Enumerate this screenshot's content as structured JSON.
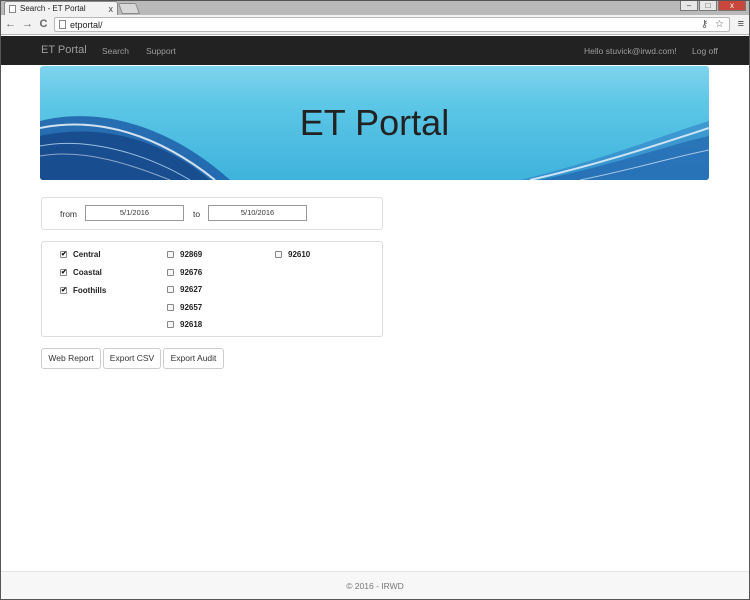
{
  "browser": {
    "tab_title": "Search - ET Portal",
    "tab_close": "x",
    "url": "etportal/",
    "win_min": "–",
    "win_max": "□",
    "win_close": "x",
    "back": "←",
    "forward": "→",
    "reload": "C",
    "url_icons": "⚷ ☆",
    "menu": "≡"
  },
  "navbar": {
    "brand": "ET Portal",
    "links": [
      "Search",
      "Support"
    ],
    "hello": "Hello stuvick@irwd.com!",
    "logoff": "Log off"
  },
  "banner": {
    "title": "ET Portal"
  },
  "date_filter": {
    "from_label": "from",
    "from_value": "5/1/2016",
    "to_label": "to",
    "to_value": "5/10/2016"
  },
  "regions": [
    {
      "label": "Central",
      "checked": true
    },
    {
      "label": "Coastal",
      "checked": true
    },
    {
      "label": "Foothills",
      "checked": true
    }
  ],
  "zips_col1": [
    {
      "label": "92869",
      "checked": false
    },
    {
      "label": "92676",
      "checked": false
    },
    {
      "label": "92627",
      "checked": false
    },
    {
      "label": "92657",
      "checked": false
    },
    {
      "label": "92618",
      "checked": false
    }
  ],
  "zips_col2": [
    {
      "label": "92610",
      "checked": false
    }
  ],
  "checkmark": "✔",
  "buttons": {
    "web_report": "Web Report",
    "export_csv": "Export CSV",
    "export_audit": "Export Audit"
  },
  "footer": {
    "text": "© 2016 - IRWD"
  },
  "colors": {
    "navbar_bg": "#222222",
    "banner_light": "#7fd3ec",
    "banner_dark": "#3fb3dc"
  }
}
